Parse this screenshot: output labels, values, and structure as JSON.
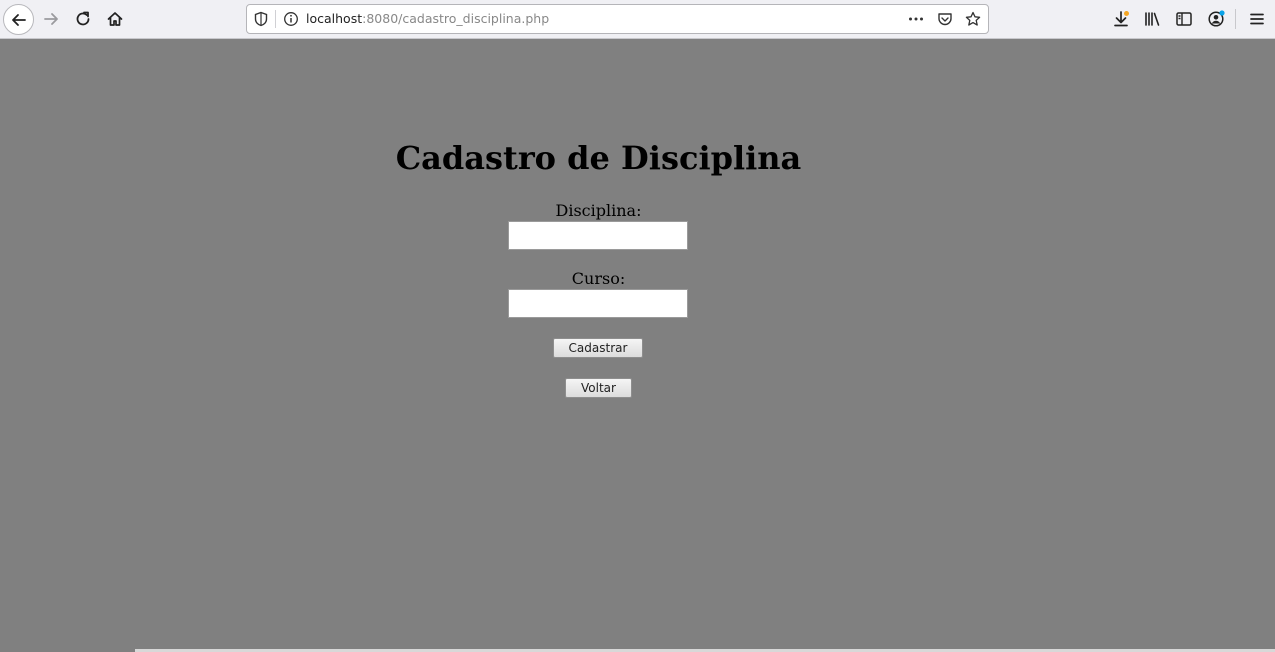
{
  "browser": {
    "url_host": "localhost",
    "url_path": ":8080/cadastro_disciplina.php",
    "notification_color": "#0aa3e8",
    "download_dot_color": "#f5a623"
  },
  "page": {
    "title": "Cadastro de Disciplina",
    "background_color": "#808080"
  },
  "form": {
    "disciplina_label": "Disciplina:",
    "disciplina_value": "",
    "curso_label": "Curso:",
    "curso_value": "",
    "submit_label": "Cadastrar",
    "back_label": "Voltar"
  }
}
